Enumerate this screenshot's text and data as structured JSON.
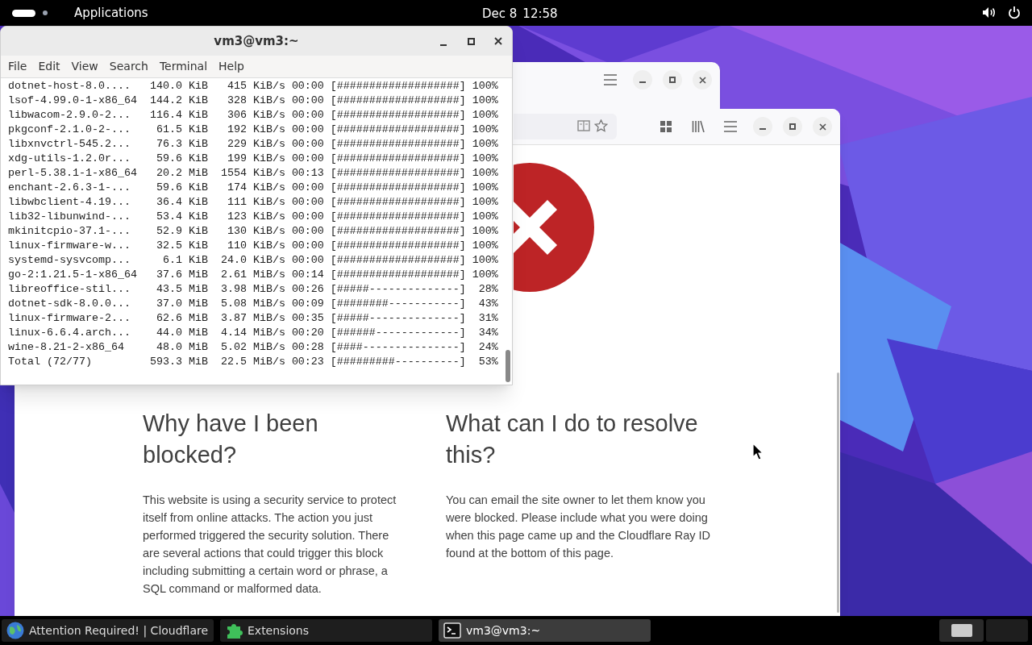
{
  "top_bar": {
    "menu": "Applications",
    "date": "Dec 8",
    "time": "12:58"
  },
  "terminal": {
    "title": "vm3@vm3:~",
    "menu": [
      "File",
      "Edit",
      "View",
      "Search",
      "Terminal",
      "Help"
    ],
    "lines": [
      {
        "name": "dotnet-host-8.0....",
        "size": "140.0 KiB",
        "speed": "415 KiB/s",
        "eta": "00:00",
        "bar": "[###################]",
        "percent": "100%"
      },
      {
        "name": "lsof-4.99.0-1-x86_64",
        "size": "144.2 KiB",
        "speed": "328 KiB/s",
        "eta": "00:00",
        "bar": "[###################]",
        "percent": "100%"
      },
      {
        "name": "libwacom-2.9.0-2...",
        "size": "116.4 KiB",
        "speed": "306 KiB/s",
        "eta": "00:00",
        "bar": "[###################]",
        "percent": "100%"
      },
      {
        "name": "pkgconf-2.1.0-2-...",
        "size": "61.5 KiB",
        "speed": "192 KiB/s",
        "eta": "00:00",
        "bar": "[###################]",
        "percent": "100%"
      },
      {
        "name": "libxnvctrl-545.2...",
        "size": "76.3 KiB",
        "speed": "229 KiB/s",
        "eta": "00:00",
        "bar": "[###################]",
        "percent": "100%"
      },
      {
        "name": "xdg-utils-1.2.0r...",
        "size": "59.6 KiB",
        "speed": "199 KiB/s",
        "eta": "00:00",
        "bar": "[###################]",
        "percent": "100%"
      },
      {
        "name": "perl-5.38.1-1-x86_64",
        "size": "20.2 MiB",
        "speed": "1554 KiB/s",
        "eta": "00:13",
        "bar": "[###################]",
        "percent": "100%"
      },
      {
        "name": "enchant-2.6.3-1-...",
        "size": "59.6 KiB",
        "speed": "174 KiB/s",
        "eta": "00:00",
        "bar": "[###################]",
        "percent": "100%"
      },
      {
        "name": "libwbclient-4.19...",
        "size": "36.4 KiB",
        "speed": "111 KiB/s",
        "eta": "00:00",
        "bar": "[###################]",
        "percent": "100%"
      },
      {
        "name": "lib32-libunwind-...",
        "size": "53.4 KiB",
        "speed": "123 KiB/s",
        "eta": "00:00",
        "bar": "[###################]",
        "percent": "100%"
      },
      {
        "name": "mkinitcpio-37.1-...",
        "size": "52.9 KiB",
        "speed": "130 KiB/s",
        "eta": "00:00",
        "bar": "[###################]",
        "percent": "100%"
      },
      {
        "name": "linux-firmware-w...",
        "size": "32.5 KiB",
        "speed": "110 KiB/s",
        "eta": "00:00",
        "bar": "[###################]",
        "percent": "100%"
      },
      {
        "name": "systemd-sysvcomp...",
        "size": "6.1 KiB",
        "speed": "24.0 KiB/s",
        "eta": "00:00",
        "bar": "[###################]",
        "percent": "100%"
      },
      {
        "name": "go-2:1.21.5-1-x86_64",
        "size": "37.6 MiB",
        "speed": "2.61 MiB/s",
        "eta": "00:14",
        "bar": "[###################]",
        "percent": "100%"
      },
      {
        "name": "libreoffice-stil...",
        "size": "43.5 MiB",
        "speed": "3.98 MiB/s",
        "eta": "00:26",
        "bar": "[#####--------------]",
        "percent": "28%"
      },
      {
        "name": "dotnet-sdk-8.0.0...",
        "size": "37.0 MiB",
        "speed": "5.08 MiB/s",
        "eta": "00:09",
        "bar": "[########-----------]",
        "percent": "43%"
      },
      {
        "name": "linux-firmware-2...",
        "size": "62.6 MiB",
        "speed": "3.87 MiB/s",
        "eta": "00:35",
        "bar": "[#####--------------]",
        "percent": "31%"
      },
      {
        "name": "linux-6.6.4.arch...",
        "size": "44.0 MiB",
        "speed": "4.14 MiB/s",
        "eta": "00:20",
        "bar": "[######-------------]",
        "percent": "34%"
      },
      {
        "name": "wine-8.21-2-x86_64",
        "size": "48.0 MiB",
        "speed": "5.02 MiB/s",
        "eta": "00:28",
        "bar": "[####---------------]",
        "percent": "24%"
      },
      {
        "name": "Total (72/77)",
        "size": "593.3 MiB",
        "speed": "22.5 MiB/s",
        "eta": "00:23",
        "bar": "[#########----------]",
        "percent": "53%"
      }
    ]
  },
  "browser": {
    "sections": [
      {
        "heading": "Why have I been blocked?",
        "body": "This website is using a security service to protect itself from online attacks. The action you just performed triggered the security solution. There are several actions that could trigger this block including submitting a certain word or phrase, a SQL command or malformed data."
      },
      {
        "heading": "What can I do to resolve this?",
        "body": "You can email the site owner to let them know you were blocked. Please include what you were doing when this page came up and the Cloudflare Ray ID found at the bottom of this page."
      }
    ]
  },
  "taskbar": {
    "items": [
      {
        "label": "Attention Required! | Cloudflare",
        "kind": "globe",
        "selected": false
      },
      {
        "label": "Extensions",
        "kind": "puzzle",
        "selected": false
      },
      {
        "label": "vm3@vm3:~",
        "kind": "terminal",
        "selected": true
      }
    ]
  }
}
